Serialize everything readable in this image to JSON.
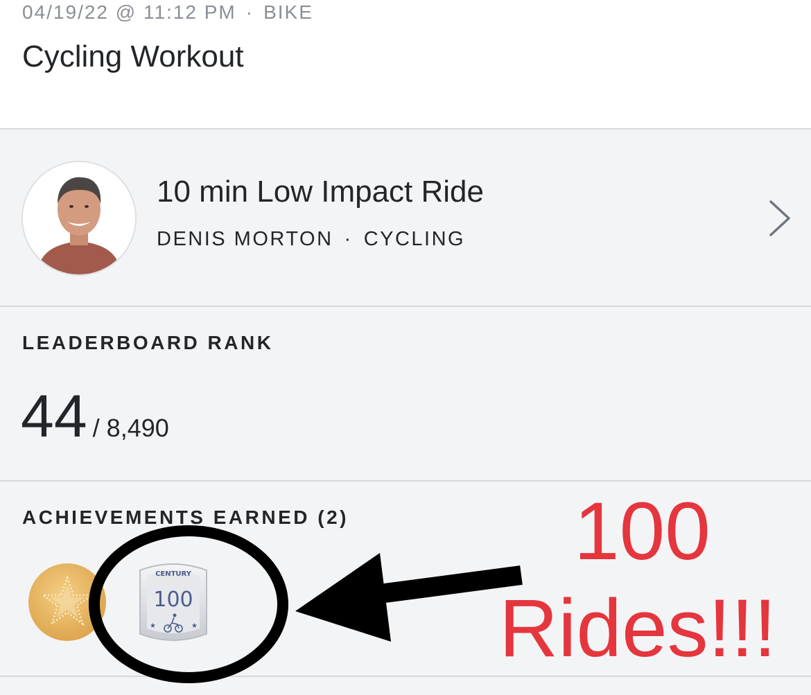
{
  "header": {
    "date_time": "04/19/22 @ 11:12 PM",
    "separator": "·",
    "device": "BIKE",
    "title": "Cycling Workout"
  },
  "class": {
    "title": "10 min Low Impact Ride",
    "instructor": "DENIS MORTON",
    "separator": "·",
    "discipline": "CYCLING"
  },
  "leaderboard": {
    "label": "LEADERBOARD RANK",
    "rank": "44",
    "total": "/ 8,490"
  },
  "achievements": {
    "label": "ACHIEVEMENTS EARNED (2)",
    "badges": [
      {
        "icon": "gold-star-badge-icon"
      },
      {
        "icon": "century-badge-icon",
        "badge_title": "CENTURY",
        "badge_number": "100"
      }
    ]
  },
  "annotation": {
    "line1": "100",
    "line2": "Rides!!!",
    "color": "#e5353d"
  }
}
